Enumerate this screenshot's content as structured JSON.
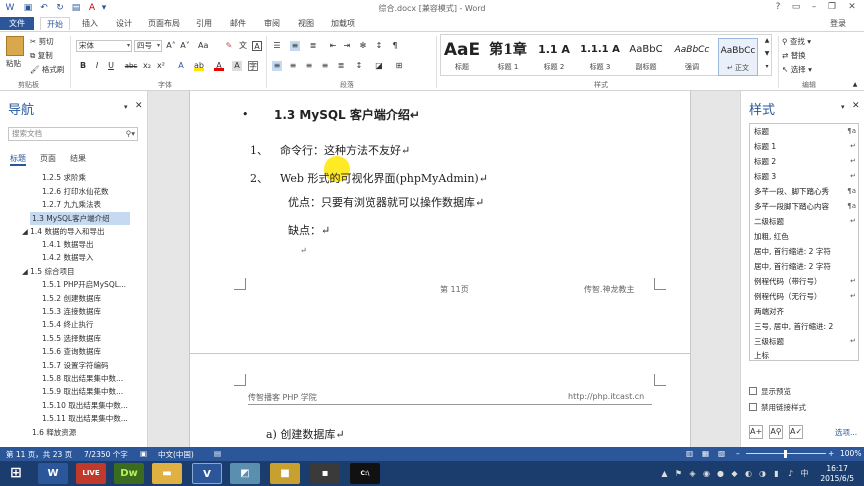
{
  "titlebar": {
    "title": "综合.docx [兼容模式] - Word",
    "help": "?",
    "login": "登录"
  },
  "tabs": [
    "文件",
    "开始",
    "插入",
    "设计",
    "页面布局",
    "引用",
    "邮件",
    "审阅",
    "视图",
    "加载项"
  ],
  "ribbon": {
    "clipboard": {
      "paste": "粘贴",
      "cut": "剪切",
      "copy": "复制",
      "format_painter": "格式刷",
      "label": "剪贴板"
    },
    "font": {
      "name": "宋体",
      "size": "四号",
      "label": "字体",
      "bold": "B",
      "italic": "I",
      "underline": "U",
      "strike": "abc"
    },
    "paragraph": {
      "label": "段落"
    },
    "styles": {
      "label": "样式",
      "items": [
        {
          "sample": "AaE",
          "name": "标题"
        },
        {
          "sample": "第1章",
          "name": "标题 1"
        },
        {
          "sample": "1.1 A",
          "name": "标题 2"
        },
        {
          "sample": "1.1.1 A",
          "name": "标题 3"
        },
        {
          "sample": "AaBbC",
          "name": "副标题"
        },
        {
          "sample": "AaBbCc",
          "name": "强调"
        },
        {
          "sample": "AaBbCc",
          "name": "↵ 正文"
        }
      ]
    },
    "editing": {
      "find": "查找",
      "replace": "替换",
      "select": "选择",
      "label": "编辑"
    }
  },
  "nav": {
    "title": "导航",
    "search_placeholder": "搜索文档",
    "tabs": [
      "标题",
      "页面",
      "结果"
    ],
    "items": [
      "1.2.5 求阶乘",
      "1.2.6 打印水仙花数",
      "1.2.7 九九乘法表",
      "1.3 MySQL客户端介绍",
      "◢ 1.4 数据的导入和导出",
      "1.4.1 数据导出",
      "1.4.2 数据导入",
      "◢ 1.5 综合项目",
      "1.5.1 PHP开启MySQL...",
      "1.5.2 创建数据库",
      "1.5.3 连接数据库",
      "1.5.4 终止执行",
      "1.5.5 选择数据库",
      "1.5.6 查询数据库",
      "1.5.7 设置字符编码",
      "1.5.8 取出结果集中数...",
      "1.5.9 取出结果集中数...",
      "1.5.10 取出结果集中数...",
      "1.5.11 取出结果集中数...",
      "1.6 释放资源"
    ]
  },
  "document": {
    "heading": "1.3   MySQL 客户端介绍↵",
    "bullet": "•",
    "line1_num": "1、",
    "line1": "命令行：这种方法不友好↵",
    "line2_num": "2、",
    "line2": "Web 形式的可视化界面(phpMyAdmin)↵",
    "pros": "优点：只要有浏览器就可以操作数据库↵",
    "cons": "缺点：↵",
    "para_mark": "↵",
    "footer_page": "第 11页",
    "footer_right": "传智.神龙教主",
    "header_left": "传智播客 PHP 学院",
    "header_right": "http://php.itcast.cn",
    "next_item": "a)  创建数据库↵"
  },
  "styles_pane": {
    "title": "样式",
    "items": [
      {
        "name": "标题",
        "mark": "¶a"
      },
      {
        "name": "标题 1",
        "mark": "↵"
      },
      {
        "name": "标题 2",
        "mark": "↵"
      },
      {
        "name": "标题 3",
        "mark": "↵"
      },
      {
        "name": "多芊一段、脚下踏心秀",
        "mark": "¶a"
      },
      {
        "name": "多芊一段脚下踏心内容",
        "mark": "¶a"
      },
      {
        "name": "二级标题",
        "mark": "↵"
      },
      {
        "name": "加粗, 红色",
        "mark": ""
      },
      {
        "name": "居中, 首行缩进:  2 字符",
        "mark": ""
      },
      {
        "name": "居中, 首行缩进:  2 字符",
        "mark": ""
      },
      {
        "name": "例程代码（带行号）",
        "mark": "↵"
      },
      {
        "name": "例程代码（无行号）",
        "mark": "↵"
      },
      {
        "name": "两端对齐",
        "mark": ""
      },
      {
        "name": "三号, 居中, 首行缩进:  2",
        "mark": ""
      },
      {
        "name": "三级标题",
        "mark": "↵"
      },
      {
        "name": "上标",
        "mark": ""
      }
    ],
    "show_preview": "显示预览",
    "disable_linked": "禁用链接样式",
    "options": "选项..."
  },
  "statusbar": {
    "page": "第 11 页，共 23 页",
    "words": "7/2350 个字",
    "lang": "中文(中国)",
    "zoom": "100%"
  },
  "taskbar": {
    "time": "16:17",
    "date": "2015/6/5",
    "apps": [
      "W",
      "LIVE",
      "Dw",
      "",
      "V",
      "",
      "",
      "C:\\"
    ]
  },
  "colors": {
    "accent": "#2b579a",
    "taskbar": "#1a3d6e",
    "highlight": "#ffe600"
  }
}
